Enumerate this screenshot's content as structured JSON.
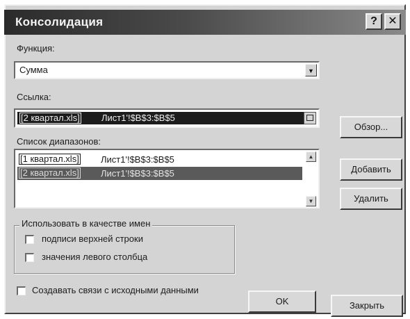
{
  "window": {
    "title": "Консолидация",
    "help_glyph": "?",
    "close_glyph": "✕"
  },
  "function": {
    "label": "Функция:",
    "value": "Сумма"
  },
  "reference": {
    "label": "Ссылка:",
    "file": "[2 квартал.xls]",
    "range": "Лист1'!$B$3:$B$5"
  },
  "ranges": {
    "label": "Список диапазонов:",
    "items": [
      {
        "file": "[1 квартал.xls]",
        "range": "Лист1'!$B$3:$B$5",
        "selected": false
      },
      {
        "file": "[2 квартал.xls]",
        "range": "Лист1'!$B$3:$B$5",
        "selected": true
      }
    ]
  },
  "buttons": {
    "browse": "Обзор...",
    "add": "Добавить",
    "delete": "Удалить",
    "ok": "OK",
    "close": "Закрыть"
  },
  "use_labels": {
    "legend": "Использовать в качестве имен",
    "top_row": "подписи верхней строки",
    "left_column": "значения левого столбца",
    "top_row_checked": false,
    "left_column_checked": false
  },
  "create_links": {
    "label": "Создавать связи с исходными данными",
    "checked": false
  },
  "colors": {
    "dialog_bg": "#d4d4d4",
    "title_dark": "#2b2b2b",
    "selection": "#202020",
    "selection_gray": "#5a5a5a"
  }
}
